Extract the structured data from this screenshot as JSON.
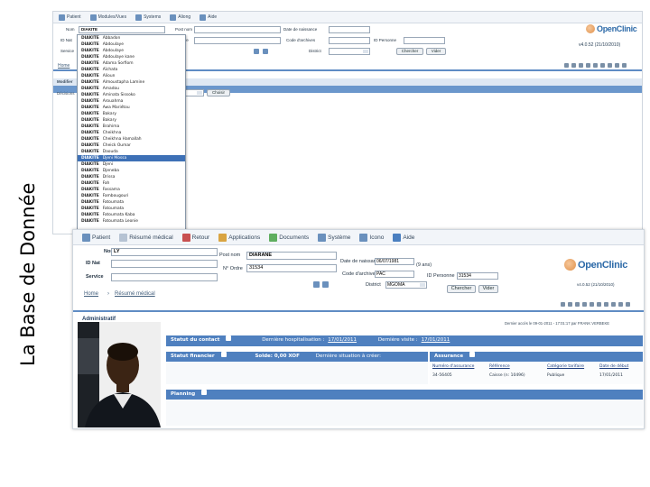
{
  "slide": {
    "title": "La Base de Donnée"
  },
  "back": {
    "menu": [
      "Patient",
      "Modules/Vues",
      "Systems",
      "Aliong",
      "Aide"
    ],
    "fields": {
      "nom": "Nom",
      "nom_value": "DIAKITE",
      "post_nom": "Post nom",
      "date_naissance": "Date de naissance",
      "id_nat": "ID Nat",
      "no_ordre": "N° Ordre",
      "code_archives": "Code d'archives",
      "id_personne": "ID Personne",
      "service": "Service",
      "district": "District"
    },
    "buttons": {
      "search": "Chercher",
      "clear": "Vider",
      "choose": "Choisir"
    },
    "logo_text": "OpenClinic",
    "version": "v4.0.52 (21/10/2010)",
    "crumb": "Home",
    "band_label": "Modifier",
    "row_label": "Décisions",
    "row_select_value": "BDN"
  },
  "dropdown": [
    {
      "last": "DIAKITE",
      "first": "Abbadon"
    },
    {
      "last": "DIAKITE",
      "first": "Abdoulaye"
    },
    {
      "last": "DIAKITE",
      "first": "Abdoulaye"
    },
    {
      "last": "DIAKITE",
      "first": "Abdoulaye kane"
    },
    {
      "last": "DIAKITE",
      "first": "Adama Sorfiom"
    },
    {
      "last": "DIAKITE",
      "first": "Aïchata"
    },
    {
      "last": "DIAKITE",
      "first": "Alioun"
    },
    {
      "last": "DIAKITE",
      "first": "Almoustapha Lamine"
    },
    {
      "last": "DIAKITE",
      "first": "Amadou"
    },
    {
      "last": "DIAKITE",
      "first": "Aminata Sissoko"
    },
    {
      "last": "DIAKITE",
      "first": "Arouahma"
    },
    {
      "last": "DIAKITE",
      "first": "Awa Mariétou"
    },
    {
      "last": "DIAKITE",
      "first": "Bakary"
    },
    {
      "last": "DIAKITE",
      "first": "Bakary"
    },
    {
      "last": "DIAKITE",
      "first": "Brahima"
    },
    {
      "last": "DIAKITE",
      "first": "Cheikhna"
    },
    {
      "last": "DIAKITE",
      "first": "Cheikhna Hamallah"
    },
    {
      "last": "DIAKITE",
      "first": "Cheick Oumar"
    },
    {
      "last": "DIAKITE",
      "first": "Daouda"
    },
    {
      "last": "DIAKITE",
      "first": "Djeni Mossa",
      "highlight": true
    },
    {
      "last": "DIAKITE",
      "first": "Djeni"
    },
    {
      "last": "DIAKITE",
      "first": "Djeneba"
    },
    {
      "last": "DIAKITE",
      "first": "Drissa"
    },
    {
      "last": "DIAKITE",
      "first": "Fah"
    },
    {
      "last": "DIAKITE",
      "first": "Fassama"
    },
    {
      "last": "DIAKITE",
      "first": "Fambougouri"
    },
    {
      "last": "DIAKITE",
      "first": "Fatoumata"
    },
    {
      "last": "DIAKITE",
      "first": "Fatoumata"
    },
    {
      "last": "DIAKITE",
      "first": "Fatoumata Kaba"
    },
    {
      "last": "DIAKITE",
      "first": "Fatoumata Leonie"
    }
  ],
  "front": {
    "menu": [
      "Patient",
      "Résumé médical",
      "Retour",
      "Applications",
      "Documents",
      "Système",
      "Icono",
      "Aide"
    ],
    "fields": {
      "nom": "Nom",
      "nom_value": "LY",
      "post_nom": "Post nom",
      "post_nom_value": "DIARANE",
      "date_naissance": "Date de naissance",
      "date_value": "06/07/1981",
      "age": "(9 ans)",
      "id_nat": "ID Nat",
      "no_ordre": "N° Ordre",
      "no_ordre_value": "31534",
      "code_archives": "Code d'archives",
      "code_value": "PAC",
      "id_personne": "ID Personne",
      "id_personne_value": "31534",
      "service": "Service",
      "district": "District",
      "district_value": "MGOMA"
    },
    "buttons": {
      "search": "Chercher",
      "clear": "Vider"
    },
    "logo_text": "OpenClinic",
    "version": "v4.0.52 (21/10/2010)",
    "crumbs": [
      "Home",
      "Résumé médical"
    ],
    "section_title": "Administratif",
    "access_info": "Dernier accès le 09-01-2011 - 17:01:17 par FRANK VERBEKE",
    "panels": {
      "contact": {
        "title": "Statut du contact",
        "last_hosp_label": "Dernière hospitalisation :",
        "last_hosp_value": "17/01/2011",
        "last_visit_label": "Dernière visite :",
        "last_visit_value": "17/01/2011"
      },
      "financial": {
        "title": "Statut financier",
        "solde": "Solde: 0,00 XOF",
        "last_pay": "Dernière situation à créer:"
      },
      "insurance": {
        "title": "Assurance",
        "headers": [
          "Numéro d'assurance",
          "Référence",
          "Catégorie tarifaire",
          "Date de début"
        ],
        "row": [
          "34-56405",
          "Caisse (n: 10496)",
          "Publique",
          "17/01/2011"
        ]
      },
      "planning": {
        "title": "Planning"
      }
    }
  }
}
